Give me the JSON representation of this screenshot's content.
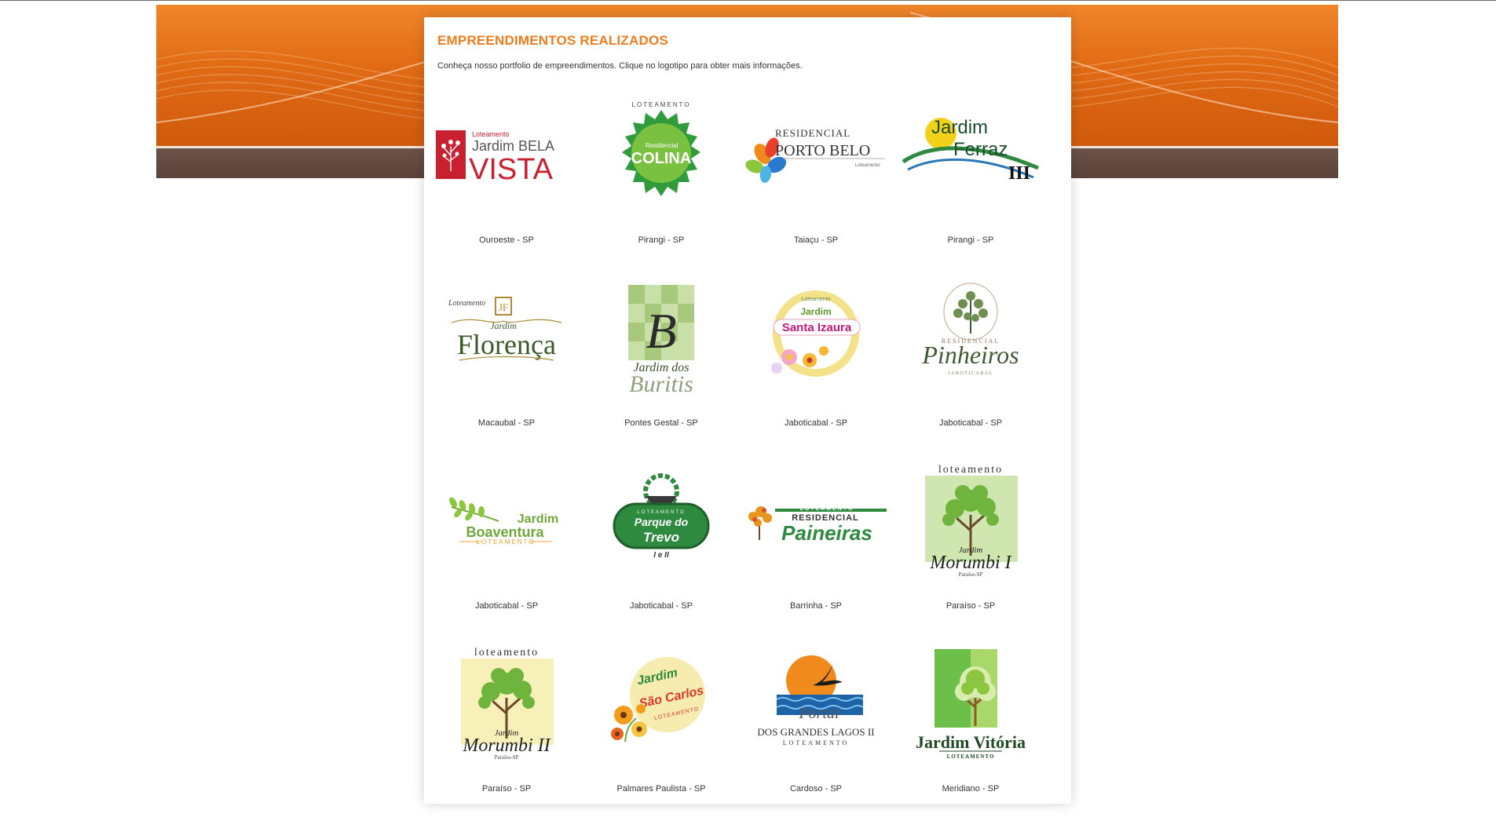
{
  "page": {
    "title": "EMPREENDIMENTOS REALIZADOS",
    "intro": "Conheça nosso portfolio de empreendimentos. Clique no logotipo para obter mais informações."
  },
  "colors": {
    "accent": "#ef7d1e",
    "banner_orange": "#e06a14",
    "banner_brown": "#5a4239"
  },
  "projects": [
    {
      "name": "bela-vista",
      "location": "Ouroeste - SP",
      "logo": {
        "top": "Loteamento",
        "mid": "Jardim BELA",
        "main": "VISTA"
      }
    },
    {
      "name": "colina",
      "location": "Pirangi - SP",
      "logo": {
        "top": "LOTEAMENTO",
        "mid": "Residencial",
        "main": "COLINA"
      }
    },
    {
      "name": "porto-belo",
      "location": "Taiaçu - SP",
      "logo": {
        "top": "RESIDENCIAL",
        "main": "PORTO BELO",
        "bottom": "Loteamento"
      }
    },
    {
      "name": "ferraz-iii",
      "location": "Pirangi - SP",
      "logo": {
        "top": "Jardim",
        "main": "Ferraz",
        "num": "III"
      }
    },
    {
      "name": "florenca",
      "location": "Macaubal - SP",
      "logo": {
        "top": "Loteamento",
        "mid": "Jardim",
        "main": "Florença",
        "mono": "JF"
      }
    },
    {
      "name": "buritis",
      "location": "Pontes Gestal - SP",
      "logo": {
        "mono": "B",
        "mid": "Jardim dos",
        "main": "Buritis"
      }
    },
    {
      "name": "santa-izaura",
      "location": "Jaboticabal - SP",
      "logo": {
        "top": "Loteamento",
        "mid": "Jardim",
        "main": "Santa Izaura"
      }
    },
    {
      "name": "pinheiros",
      "location": "Jaboticabal - SP",
      "logo": {
        "top": "RESIDENCIAL",
        "main": "Pinheiros",
        "bottom": "JABOTICABAL"
      }
    },
    {
      "name": "boaventura",
      "location": "Jaboticabal - SP",
      "logo": {
        "mid": "Jardim",
        "main": "Boaventura",
        "bottom": "LOTEAMENTO"
      }
    },
    {
      "name": "parque-do-trevo",
      "location": "Jaboticabal - SP",
      "logo": {
        "top": "LOTEAMENTO",
        "mid": "Parque do",
        "main": "Trevo",
        "bottom": "I e II"
      }
    },
    {
      "name": "paineiras",
      "location": "Barrinha - SP",
      "logo": {
        "top": "LOTEAMENTO",
        "mid": "RESIDENCIAL",
        "main": "Paineiras"
      }
    },
    {
      "name": "morumbi-i",
      "location": "Paraíso - SP",
      "logo": {
        "top": "loteamento",
        "mid": "Jardim",
        "main": "Morumbi I",
        "bottom": "Paraíso-SP"
      }
    },
    {
      "name": "morumbi-ii",
      "location": "Paraíso - SP",
      "logo": {
        "top": "loteamento",
        "mid": "Jardim",
        "main": "Morumbi II",
        "bottom": "Paraíso-SP"
      }
    },
    {
      "name": "sao-carlos",
      "location": "Palmares Paulista - SP",
      "logo": {
        "top": "Jardim",
        "main": "São Carlos",
        "bottom": "LOTEAMENTO"
      }
    },
    {
      "name": "portal-grandes-lagos",
      "location": "Cardoso - SP",
      "logo": {
        "top": "Portal",
        "main": "DOS GRANDES LAGOS II",
        "bottom": "LOTEAMENTO"
      }
    },
    {
      "name": "jardim-vitoria",
      "location": "Meridiano - SP",
      "logo": {
        "main": "Jardim Vitória",
        "bottom": "LOTEAMENTO"
      }
    }
  ]
}
